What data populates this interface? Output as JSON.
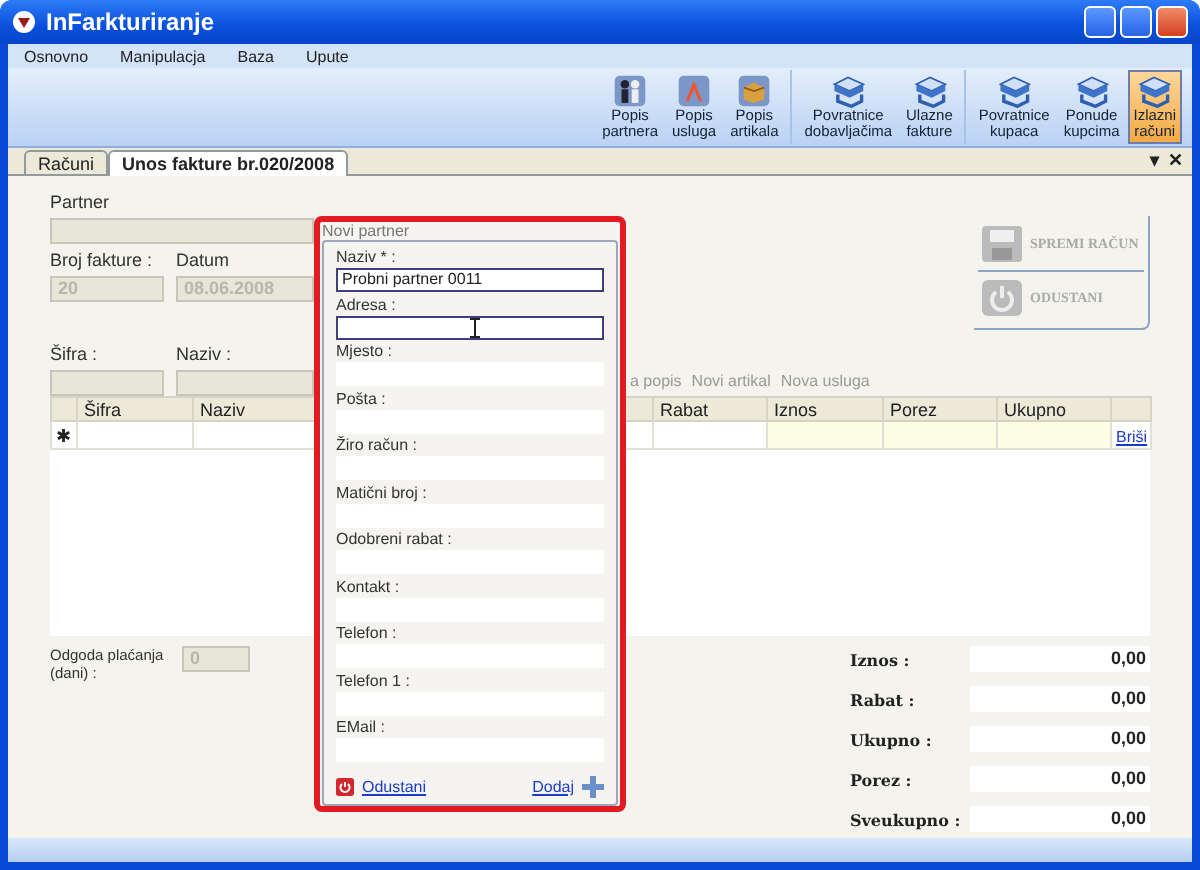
{
  "window": {
    "title": "InFarkturiranje"
  },
  "menu": [
    "Osnovno",
    "Manipulacja",
    "Baza",
    "Upute"
  ],
  "toolbar": [
    [
      {
        "label": "Popis partnera",
        "kind": "people",
        "selected": false
      },
      {
        "label": "Popis usluga",
        "kind": "pen",
        "selected": false
      },
      {
        "label": "Popis artikala",
        "kind": "box",
        "selected": false
      }
    ],
    [
      {
        "label": "Povratnice dobavljačima",
        "kind": "stack",
        "selected": false
      },
      {
        "label": "Ulazne fakture",
        "kind": "stack",
        "selected": false
      }
    ],
    [
      {
        "label": "Povratnice kupaca",
        "kind": "stack",
        "selected": false
      },
      {
        "label": "Ponude kupcima",
        "kind": "stack",
        "selected": false
      },
      {
        "label": "Izlazni računi",
        "kind": "stack",
        "selected": true
      }
    ]
  ],
  "tabs": [
    {
      "label": "Računi",
      "selected": false
    },
    {
      "label": "Unos fakture br.020/2008",
      "selected": true
    }
  ],
  "tab_controls": [
    "▾",
    "✕"
  ],
  "form": {
    "partner": {
      "label": "Partner",
      "disabled": true
    },
    "invoice_number": {
      "label": "Broj fakture :",
      "value": "20",
      "disabled": true
    },
    "date": {
      "label": "Datum",
      "value": "08.06.2008",
      "disabled": true
    },
    "code": {
      "label": "Šifra :",
      "disabled": true
    },
    "name": {
      "label": "Naziv :",
      "disabled": true
    },
    "links": [
      "a popis",
      "Novi artikal",
      "Nova usluga"
    ],
    "payment_delay": {
      "label": "Odgoda plaćanja (dani) :",
      "value": "0",
      "disabled": true
    }
  },
  "actions": [
    {
      "label": "SPREMI RAČUN",
      "kind": "disk",
      "disabled": true
    },
    {
      "label": "ODUSTANI",
      "kind": "power",
      "disabled": true
    }
  ],
  "table": {
    "columns": [
      {
        "label": "Šifra",
        "kind": "plain"
      },
      {
        "label": "Naziv",
        "kind": "plain"
      },
      {
        "label": "Rabat",
        "kind": "plain"
      },
      {
        "label": "Iznos",
        "kind": "computed"
      },
      {
        "label": "Porez",
        "kind": "computed"
      },
      {
        "label": "Ukupno",
        "kind": "computed"
      }
    ],
    "new_row": {
      "marker": "✱",
      "action": "Briši"
    }
  },
  "totals": [
    {
      "label": "Iznos :",
      "value": "0,00"
    },
    {
      "label": "Rabat :",
      "value": "0,00"
    },
    {
      "label": "Ukupno :",
      "value": "0,00"
    },
    {
      "label": "Porez :",
      "value": "0,00"
    },
    {
      "label": "Sveukupno :",
      "value": "0,00"
    }
  ],
  "popup": {
    "title": "Novi partner",
    "fields": [
      {
        "label": "Naziv * :",
        "value": "Probni partner 0011",
        "highlighted": true
      },
      {
        "label": "Adresa :",
        "highlighted": true
      },
      {
        "label": "Mjesto :",
        "highlighted": false
      },
      {
        "label": "Pošta :",
        "highlighted": false
      },
      {
        "label": "Žiro račun :",
        "highlighted": false
      },
      {
        "label": "Matični broj :",
        "highlighted": false
      },
      {
        "label": "Odobreni rabat  :",
        "highlighted": false
      },
      {
        "label": "Kontakt :",
        "highlighted": false
      },
      {
        "label": "Telefon :",
        "highlighted": false
      },
      {
        "label": "Telefon 1 :",
        "highlighted": false
      },
      {
        "label": "EMail :",
        "highlighted": false
      }
    ],
    "cancel": "Odustani",
    "add": "Dodaj"
  }
}
